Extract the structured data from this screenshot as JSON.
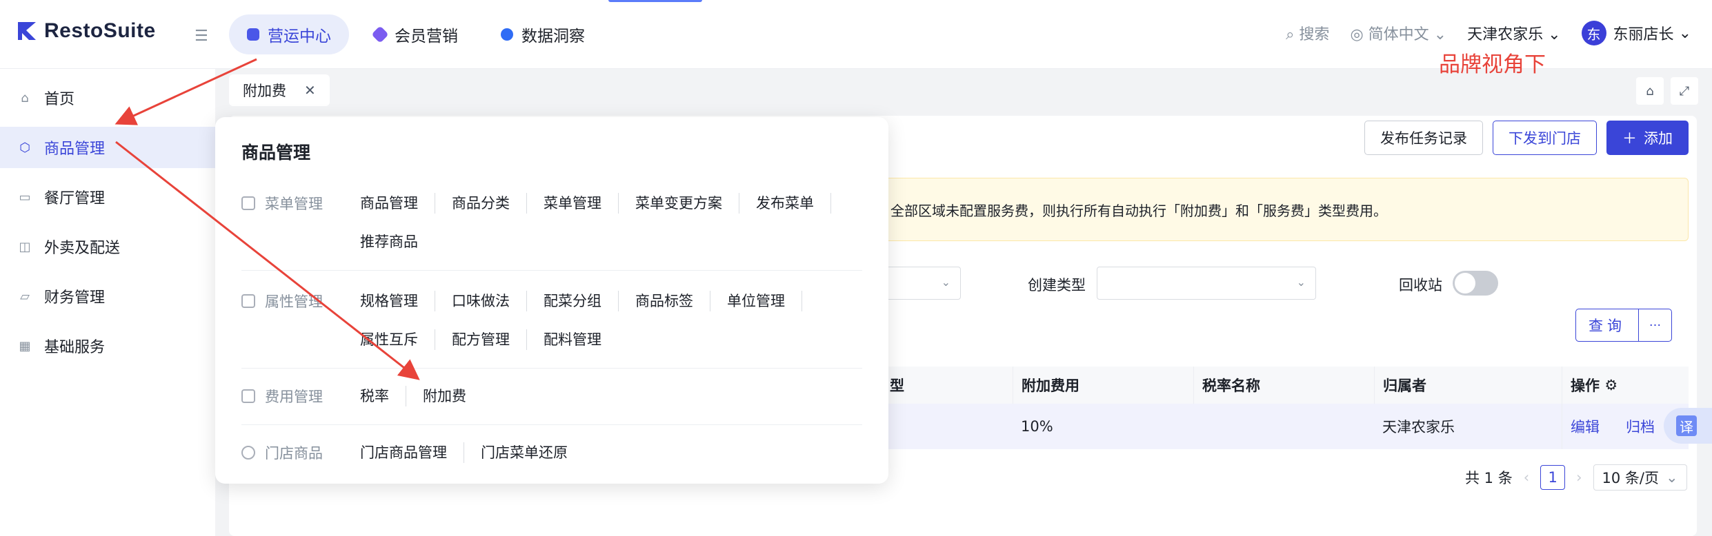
{
  "header": {
    "logo": "RestoSuite",
    "modules": [
      {
        "label": "营运中心",
        "color": "#4a57e8"
      },
      {
        "label": "会员营销",
        "color": "#7b5cf0"
      },
      {
        "label": "数据洞察",
        "color": "#2f6cf5"
      }
    ],
    "search": "搜索",
    "language": "简体中文",
    "store": "天津农家乐",
    "avatar_char": "东",
    "user": "东丽店长",
    "annotation": "品牌视角下",
    "annotation_color": "#e8433a"
  },
  "sidebar": {
    "items": [
      {
        "label": "首页",
        "icon": "home-icon"
      },
      {
        "label": "商品管理",
        "icon": "box-icon"
      },
      {
        "label": "餐厅管理",
        "icon": "store-icon"
      },
      {
        "label": "外卖及配送",
        "icon": "bag-icon"
      },
      {
        "label": "财务管理",
        "icon": "folder-icon"
      },
      {
        "label": "基础服务",
        "icon": "grid-icon"
      }
    ]
  },
  "page_tab": "附加费",
  "toolbar": {
    "publish_log": "发布任务记录",
    "dispatch": "下发到门店",
    "add": "添加"
  },
  "notice": "全部区域未配置服务费，则执行所有自动执行「附加费」和「服务费」类型费用。",
  "filters": {
    "create_type_label": "创建类型",
    "recycle_label": "回收站",
    "query": "查询",
    "more": "···"
  },
  "table": {
    "columns": [
      "型",
      "附加费用",
      "税率名称",
      "归属者",
      "操作"
    ],
    "row": {
      "fee": "10%",
      "tax": "",
      "owner": "天津农家乐",
      "edit": "编辑",
      "archive": "归档"
    }
  },
  "translate": "译",
  "pagination": {
    "total": "共 1 条",
    "page": "1",
    "size": "10 条/页"
  },
  "mega_menu": {
    "title": "商品管理",
    "groups": [
      {
        "label": "菜单管理",
        "links": [
          "商品管理",
          "商品分类",
          "菜单管理",
          "菜单变更方案",
          "发布菜单",
          "推荐商品"
        ]
      },
      {
        "label": "属性管理",
        "links": [
          "规格管理",
          "口味做法",
          "配菜分组",
          "商品标签",
          "单位管理",
          "属性互斥",
          "配方管理",
          "配料管理"
        ]
      },
      {
        "label": "费用管理",
        "links": [
          "税率",
          "附加费"
        ]
      },
      {
        "label": "门店商品",
        "links": [
          "门店商品管理",
          "门店菜单还原"
        ]
      }
    ]
  },
  "arrow_color": "#e8433a"
}
